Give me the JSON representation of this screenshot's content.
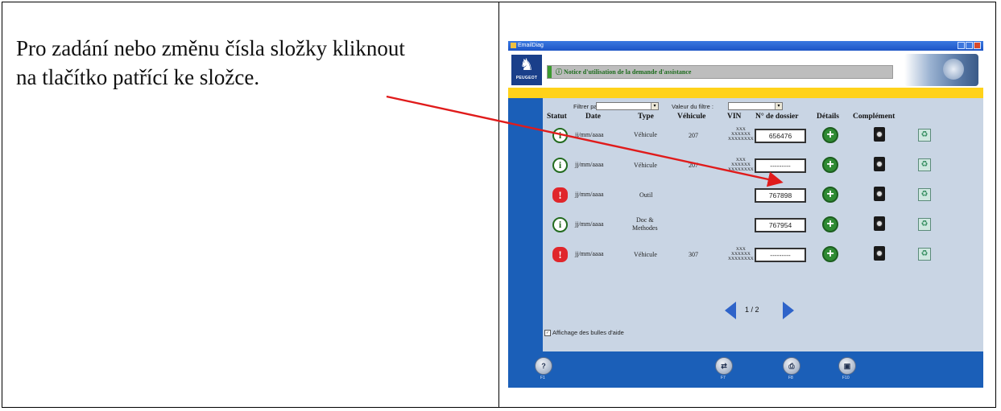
{
  "instruction": {
    "line1": "Pro zadání nebo změnu čísla složky kliknout",
    "line2": "na tlačítko patřící ke složce."
  },
  "app": {
    "window_title": "EmailDiag",
    "logo_text": "PEUGEOT",
    "notice_title": "Notice d'utilisation de la demande d'assistance",
    "filter": {
      "filter_label": "Filtrer par :",
      "filter_value": "",
      "value_label": "Valeur du filtre :",
      "value_value": ""
    },
    "columns": {
      "statut": "Statut",
      "date": "Date",
      "type": "Type",
      "vehicule": "Véhicule",
      "vin": "VIN",
      "dossier": "N° de dossier",
      "details": "Détails",
      "complement": "Complément"
    },
    "rows": [
      {
        "status": "info",
        "date": "jj/mm/aaaa",
        "type": "Véhicule",
        "vehicule": "207",
        "vin1": "XXX",
        "vin2": "XXXXXX",
        "vin3": "XXXXXXXX",
        "dossier": "656476"
      },
      {
        "status": "info",
        "date": "jj/mm/aaaa",
        "type": "Véhicule",
        "vehicule": "207",
        "vin1": "XXX",
        "vin2": "XXXXXX",
        "vin3": "XXXXXXXX",
        "dossier": "---------"
      },
      {
        "status": "warning",
        "date": "jj/mm/aaaa",
        "type": "Outil",
        "vehicule": "",
        "vin1": "",
        "vin2": "",
        "vin3": "",
        "dossier": "767898"
      },
      {
        "status": "info",
        "date": "jj/mm/aaaa",
        "type": "Doc &",
        "type2": "Methodes",
        "vehicule": "",
        "vin1": "",
        "vin2": "",
        "vin3": "",
        "dossier": "767954"
      },
      {
        "status": "warning",
        "date": "jj/mm/aaaa",
        "type": "Véhicule",
        "vehicule": "307",
        "vin1": "XXX",
        "vin2": "XXXXXX",
        "vin3": "XXXXXXXX",
        "dossier": "---------"
      }
    ],
    "pagination": "1 / 2",
    "help_bubbles_label": "Affichage des bulles d'aide",
    "bottom_keys": [
      "F1",
      "F7",
      "F8",
      "F10"
    ]
  },
  "colors": {
    "frame_blue": "#1b5fb8",
    "content_bg": "#c9d5e4",
    "stripe_yellow": "#ffd21a",
    "arrow_red": "#e01b1b",
    "status_info": "#236b1f",
    "status_warning": "#e0262b"
  },
  "icons": [
    "peugeot-lion-icon",
    "info-status-icon",
    "warning-status-icon",
    "plus-details-icon",
    "camera-complement-icon",
    "recycle-icon",
    "prev-page-icon",
    "next-page-icon",
    "help-icon",
    "print-icon",
    "save-icon"
  ]
}
